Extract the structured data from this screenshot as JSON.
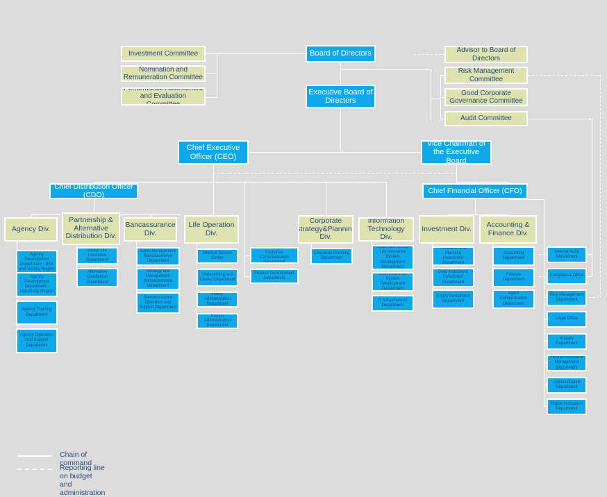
{
  "legend": {
    "solid_label": "Chain of command",
    "dashed_label": "Reporting line on budget and administration"
  },
  "nodes": {
    "board_of_directors": "Board of Directors",
    "executive_board": "Executive Board of Directors",
    "investment_committee": "Investment Committee",
    "nomination_committee": "Nomination and Remuneration Committee",
    "performance_committee": "Performance Assessment and Evaluation Committee",
    "advisor": "Advisor to Board of Directors",
    "risk_management_committee": "Risk Management Committee",
    "good_corporate_governance_committee": "Good Corporate Governance Committee",
    "audit_committee": "Audit Committee",
    "ceo": "Chief Executive Officer (CEO)",
    "vice_chairman": "Vice Chairman of the Executive Board",
    "cdo": "Chief Distribution Officer (CDO)",
    "cfo": "Chief Financial Officer (CFO)"
  },
  "divisions": [
    {
      "name": "Agency Div.",
      "departments": [
        "Agency Development Department - BKK and Vicinity Region",
        "Agency Development Department - Upcountry Region",
        "Agency Training Department",
        "Agency Operation And Support Department"
      ]
    },
    {
      "name": "Partnership & Alternative Distribution Div.",
      "departments": [
        "Group Life Insurance Department",
        "Alternative Distribution Department"
      ]
    },
    {
      "name": "Bancassurance Div.",
      "departments": [
        "Sales Management Bancassurance Department",
        "Strategy and Management Bancassurance Department",
        "Bancassurance Operation and Support Department"
      ]
    },
    {
      "name": "Life Operation Div.",
      "departments": [
        "Medical Service Center",
        "Underwriting and Claims Department",
        "Policy Administration Department",
        "Branch Administration Department"
      ]
    },
    {
      "name": "Corporate Strategy&Planning Div.",
      "departments": [
        "Corporate Planning Department"
      ]
    },
    {
      "name": "Information Technology Div.",
      "departments": [
        "Claim and Group Life Insurance System Development Department",
        "Core Insurance System Development Department",
        "IT Infrastructure Department"
      ]
    },
    {
      "name": "Investment Div.",
      "departments": [
        "Research and Planning Investment Department",
        "Debt Instrument Investment Department",
        "Equity Investment Department"
      ]
    },
    {
      "name": "Accounting & Finance Div.",
      "departments": [
        "Accounting Department",
        "Finance Department",
        "Agent Compensation Department"
      ]
    }
  ],
  "ceo_direct_departments": [
    "Marketing and Corporate Communication Department",
    "Product Development Department"
  ],
  "standalone_departments": [
    "Internal Audit Department",
    "Compliance Office",
    "Risk Management Department",
    "Legal Office",
    "Actuary Department",
    "Human Resource Management Department",
    "Administration Department",
    "Digital Innovation Department"
  ],
  "colors": {
    "background": "#dcdcdc",
    "committee_box": "#dde2ae",
    "executive_box": "#0fa8e8",
    "text_navy": "#2b4a7e",
    "line": "#ffffff"
  }
}
